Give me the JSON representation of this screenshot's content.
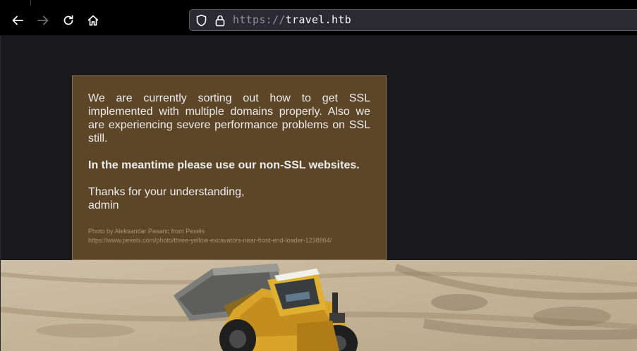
{
  "browser": {
    "url_scheme": "https://",
    "url_host": "travel.htb",
    "icons": {
      "back": "arrow-left-icon",
      "forward": "arrow-right-icon",
      "reload": "reload-icon",
      "home": "home-icon",
      "shield": "shield-icon",
      "lock": "lock-icon"
    }
  },
  "notice": {
    "paragraph1": "We are currently sorting out how to get SSL implemented with multiple domains properly. Also we are experiencing severe performance problems on SSL still.",
    "paragraph2": "In the meantime please use our non-SSL websites.",
    "thanks": "Thanks for your understanding,",
    "signature": "admin",
    "photo_credit": "Photo by Aleksandar Pasaric from Pexels",
    "photo_url": "https://www.pexels.com/photo/three-yellow-excavators-near-front-end-loader-1238864/"
  },
  "colors": {
    "toolbar_bg": "#000000",
    "page_bg": "#19181c",
    "notice_bg": "#5d4627",
    "loader_yellow": "#d9a42a"
  }
}
